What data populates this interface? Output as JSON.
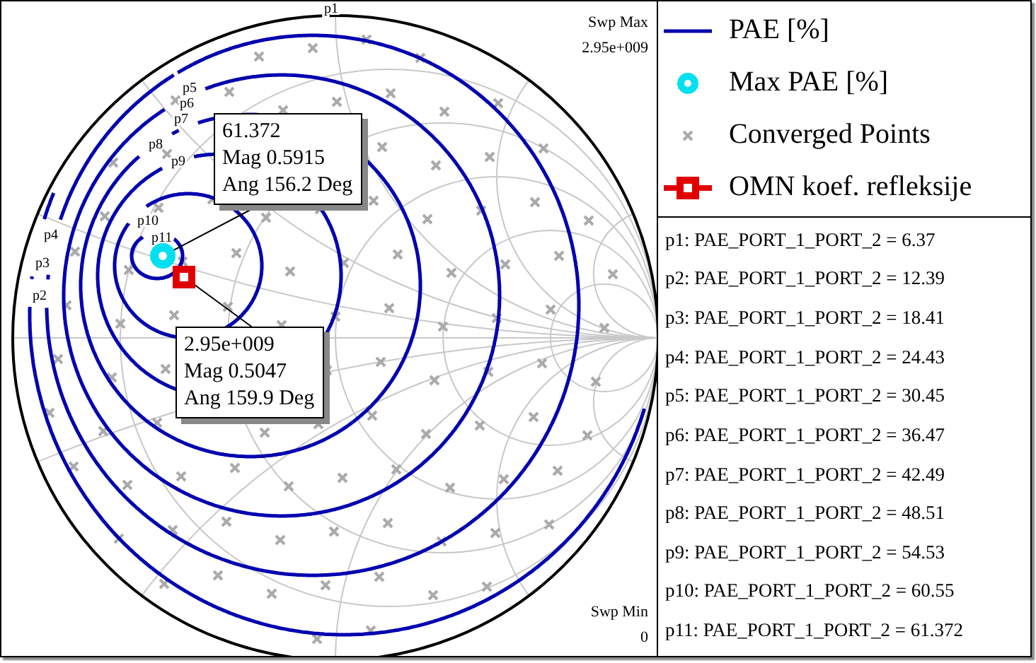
{
  "chart": {
    "sweep_max": {
      "label": "Swp Max",
      "value": "2.95e+009"
    },
    "sweep_min": {
      "label": "Swp Min",
      "value": "0"
    },
    "contour_labels": [
      "p1",
      "p2",
      "p3",
      "p4",
      "p5",
      "p6",
      "p7",
      "p8",
      "p9",
      "p10",
      "p11"
    ],
    "markers": [
      {
        "kind": "ring",
        "lines": [
          "61.372",
          "Mag 0.5915",
          "Ang 156.2 Deg"
        ]
      },
      {
        "kind": "square",
        "lines": [
          "2.95e+009",
          "Mag 0.5047",
          "Ang 159.9 Deg"
        ]
      }
    ]
  },
  "legend": {
    "items": [
      {
        "kind": "line",
        "label": "PAE [%]"
      },
      {
        "kind": "ring",
        "label": "Max PAE [%]"
      },
      {
        "kind": "cross",
        "label": "Converged Points"
      },
      {
        "kind": "square_line",
        "label": "OMN koef. refleksije"
      }
    ],
    "values": [
      "p1: PAE_PORT_1_PORT_2 = 6.37",
      "p2: PAE_PORT_1_PORT_2 = 12.39",
      "p3: PAE_PORT_1_PORT_2 = 18.41",
      "p4: PAE_PORT_1_PORT_2 = 24.43",
      "p5: PAE_PORT_1_PORT_2 = 30.45",
      "p6: PAE_PORT_1_PORT_2 = 36.47",
      "p7: PAE_PORT_1_PORT_2 = 42.49",
      "p8: PAE_PORT_1_PORT_2 = 48.51",
      "p9: PAE_PORT_1_PORT_2 = 54.53",
      "p10: PAE_PORT_1_PORT_2 = 60.55",
      "p11: PAE_PORT_1_PORT_2 = 61.372"
    ]
  }
}
